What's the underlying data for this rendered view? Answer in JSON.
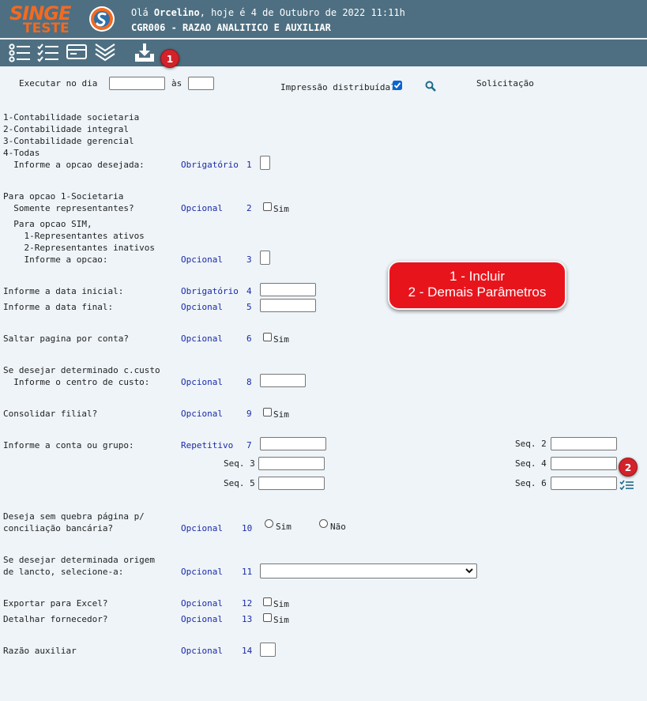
{
  "header": {
    "logo_top": "SINGE",
    "logo_bottom": "TESTE",
    "greeting_prefix": "Olá ",
    "user": "Orcelino",
    "greeting_suffix": ", hoje é 4 de Outubro de 2022 11:11h",
    "program": "CGR006 - RAZAO ANALITICO E AUXILIAR",
    "colors": {
      "bar": "#4e6f82",
      "logo": "#f26a21",
      "marker": "#d3222a",
      "callout": "#e8141c",
      "link": "#1a2aa8"
    }
  },
  "toolbar": {
    "icons": [
      "list-icon",
      "checklist-icon",
      "card-icon",
      "chevrons-down-icon",
      "download-tray-icon"
    ],
    "marker1": "1"
  },
  "schedule": {
    "executar_label": "Executar no dia",
    "as_label": "às",
    "distrib_label": "Impressão distribuída?",
    "distrib_checked": true,
    "solicitacao_label": "Solicitação"
  },
  "options": {
    "opt1": "1-Contabilidade societaria",
    "opt2": "2-Contabilidade integral",
    "opt3": "3-Contabilidade gerencial",
    "opt4": "4-Todas"
  },
  "callout": {
    "line1": "1 - Incluir",
    "line2": "2 - Demais Parâmetros"
  },
  "marker2": "2",
  "fields": {
    "f1_label": "  Informe a opcao desejada:",
    "f1_req": "Obrigatório",
    "f1_num": "1",
    "socie_title": "Para opcao 1-Societaria",
    "f2_label": "  Somente representantes?",
    "f2_req": "Opcional",
    "f2_num": "2",
    "f2_sim": "Sim",
    "sim_title": "  Para opcao SIM,",
    "sim_opt1": "    1-Representantes ativos",
    "sim_opt2": "    2-Representantes inativos",
    "f3_label": "    Informe a opcao:",
    "f3_req": "Opcional",
    "f3_num": "3",
    "f4_label": "Informe a data inicial:",
    "f4_req": "Obrigatório",
    "f4_num": "4",
    "f5_label": "Informe a data final:",
    "f5_req": "Opcional",
    "f5_num": "5",
    "f6_label": "Saltar pagina por conta?",
    "f6_req": "Opcional",
    "f6_num": "6",
    "f6_sim": "Sim",
    "ccusto_title": "Se desejar determinado c.custo",
    "f8_label": "  Informe o centro de custo:",
    "f8_req": "Opcional",
    "f8_num": "8",
    "f9_label": "Consolidar filial?",
    "f9_req": "Opcional",
    "f9_num": "9",
    "f9_sim": "Sim",
    "f7_label": "Informe a conta ou grupo:",
    "f7_req": "Repetitivo",
    "f7_num": "7",
    "seq2": "Seq. 2",
    "seq3": "Seq. 3",
    "seq4": "Seq. 4",
    "seq5": "Seq. 5",
    "seq6": "Seq. 6",
    "f10_label1": "Deseja sem quebra página p/",
    "f10_label2": "conciliação bancária?",
    "f10_req": "Opcional",
    "f10_num": "10",
    "f10_sim": "Sim",
    "f10_nao": "Não",
    "f11_label1": "Se desejar determinada origem",
    "f11_label2": "de lancto, selecione-a:",
    "f11_req": "Opcional",
    "f11_num": "11",
    "f12_label": "Exportar para Excel?",
    "f12_req": "Opcional",
    "f12_num": "12",
    "f12_sim": "Sim",
    "f13_label": "Detalhar fornecedor?",
    "f13_req": "Opcional",
    "f13_num": "13",
    "f13_sim": "Sim",
    "f14_label": "Razão auxiliar",
    "f14_req": "Opcional",
    "f14_num": "14"
  }
}
